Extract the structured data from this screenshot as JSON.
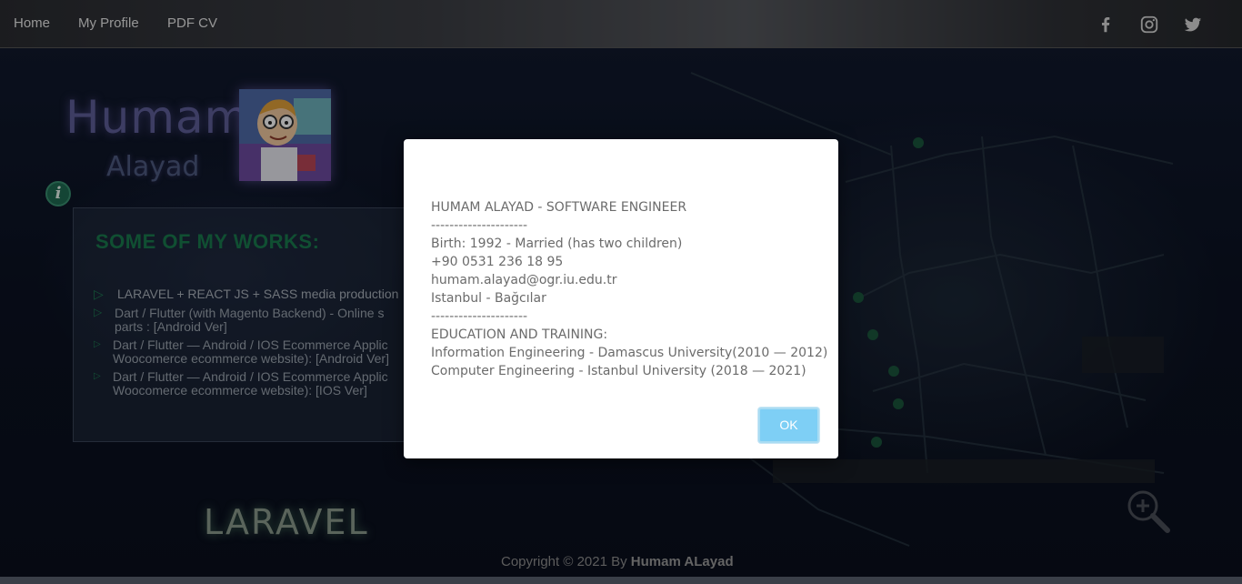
{
  "nav": {
    "links": [
      "Home",
      "My Profile",
      "PDF CV"
    ],
    "social": [
      "facebook-icon",
      "instagram-icon",
      "twitter-icon"
    ]
  },
  "profile": {
    "first_name": "Humam",
    "last_name": "Alayad"
  },
  "works": {
    "title": "SOME OF MY WORKS:",
    "items": [
      [
        "LARAVEL + REACT JS + SASS media production"
      ],
      [
        "Dart / Flutter (with Magento Backend) - Online s",
        "parts : [Android Ver]"
      ],
      [
        "Dart / Flutter — Android / IOS Ecommerce Applic",
        "Woocomerce ecommerce website): [Android Ver]"
      ],
      [
        "Dart / Flutter — Android / IOS Ecommerce Applic",
        "Woocomerce ecommerce website): [IOS Ver]"
      ]
    ]
  },
  "banner": {
    "label": "LARAVEL"
  },
  "footer": {
    "copyright_prefix": "Copyright © 2021 By ",
    "copyright_name": "Humam ALayad"
  },
  "modal": {
    "lines": [
      "HUMAM ALAYAD - SOFTWARE ENGINEER",
      "---------------------",
      "Birth: 1992 - Married (has two children)",
      "+90 0531 236 18 95",
      "humam.alayad@ogr.iu.edu.tr",
      "Istanbul - Bağcılar",
      "---------------------",
      "EDUCATION AND TRAINING:",
      "Information Engineering - Damascus University(2010 — 2012)",
      "Computer Engineering - Istanbul University (2018 — 2021)"
    ],
    "ok_label": "OK"
  },
  "colors": {
    "accent_green": "#1a7a4e",
    "ok_button": "#7ecff5"
  }
}
